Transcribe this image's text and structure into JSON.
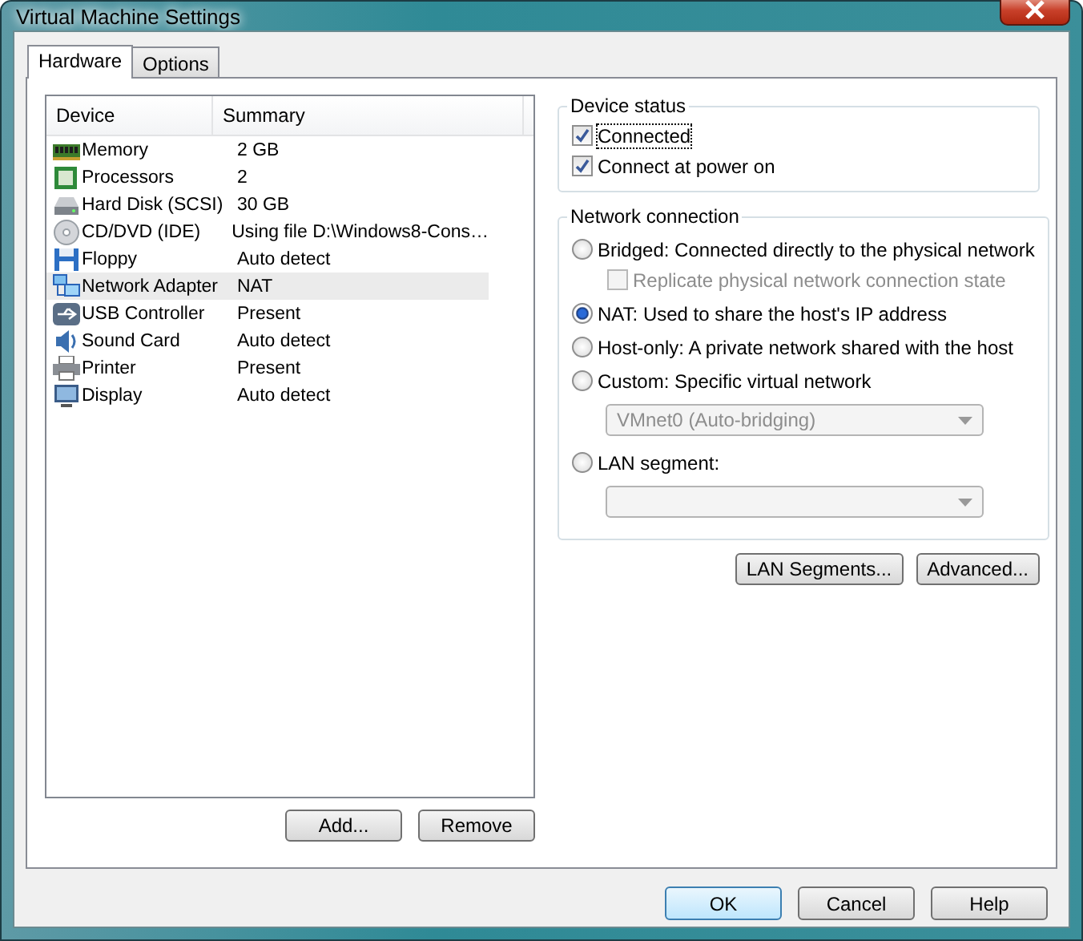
{
  "window": {
    "title": "Virtual Machine Settings"
  },
  "tabs": [
    {
      "label": "Hardware",
      "selected": true
    },
    {
      "label": "Options",
      "selected": false
    }
  ],
  "devices": {
    "columns": [
      "Device",
      "Summary"
    ],
    "rows": [
      {
        "kind": "memory",
        "device": "Memory",
        "summary": "2 GB",
        "selected": false
      },
      {
        "kind": "processor",
        "device": "Processors",
        "summary": "2",
        "selected": false
      },
      {
        "kind": "disk",
        "device": "Hard Disk (SCSI)",
        "summary": "30 GB",
        "selected": false
      },
      {
        "kind": "cd",
        "device": "CD/DVD (IDE)",
        "summary": "Using file D:\\Windows8-Cons…",
        "selected": false
      },
      {
        "kind": "floppy",
        "device": "Floppy",
        "summary": "Auto detect",
        "selected": false
      },
      {
        "kind": "network",
        "device": "Network Adapter",
        "summary": "NAT",
        "selected": true
      },
      {
        "kind": "usb",
        "device": "USB Controller",
        "summary": "Present",
        "selected": false
      },
      {
        "kind": "sound",
        "device": "Sound Card",
        "summary": "Auto detect",
        "selected": false
      },
      {
        "kind": "printer",
        "device": "Printer",
        "summary": "Present",
        "selected": false
      },
      {
        "kind": "display",
        "device": "Display",
        "summary": "Auto detect",
        "selected": false
      }
    ]
  },
  "list_buttons": [
    "Add...",
    "Remove"
  ],
  "device_status": {
    "title": "Device status",
    "items": [
      {
        "label": "Connected",
        "checked": true
      },
      {
        "label": "Connect at power on",
        "checked": true
      }
    ]
  },
  "network_connection": {
    "title": "Network connection",
    "items": [
      {
        "kind": "radio",
        "label": "Bridged: Connected directly to the physical network",
        "selected": false
      },
      {
        "kind": "checkbox",
        "label": "Replicate physical network connection state",
        "checked": false,
        "disabled": true
      },
      {
        "kind": "radio",
        "label": "NAT: Used to share the host's IP address",
        "selected": true
      },
      {
        "kind": "radio",
        "label": "Host-only: A private network shared with the host",
        "selected": false
      },
      {
        "kind": "radio",
        "label": "Custom: Specific virtual network",
        "selected": false
      },
      {
        "kind": "select",
        "value": "VMnet0 (Auto-bridging)",
        "disabled": true
      },
      {
        "kind": "radio",
        "label": "LAN segment:",
        "selected": false
      },
      {
        "kind": "select",
        "disabled": true
      }
    ]
  },
  "network_buttons": [
    "LAN Segments...",
    "Advanced..."
  ],
  "dialog_buttons": [
    {
      "label": "OK",
      "default": true
    },
    {
      "label": "Cancel",
      "default": false
    },
    {
      "label": "Help",
      "default": false
    }
  ]
}
